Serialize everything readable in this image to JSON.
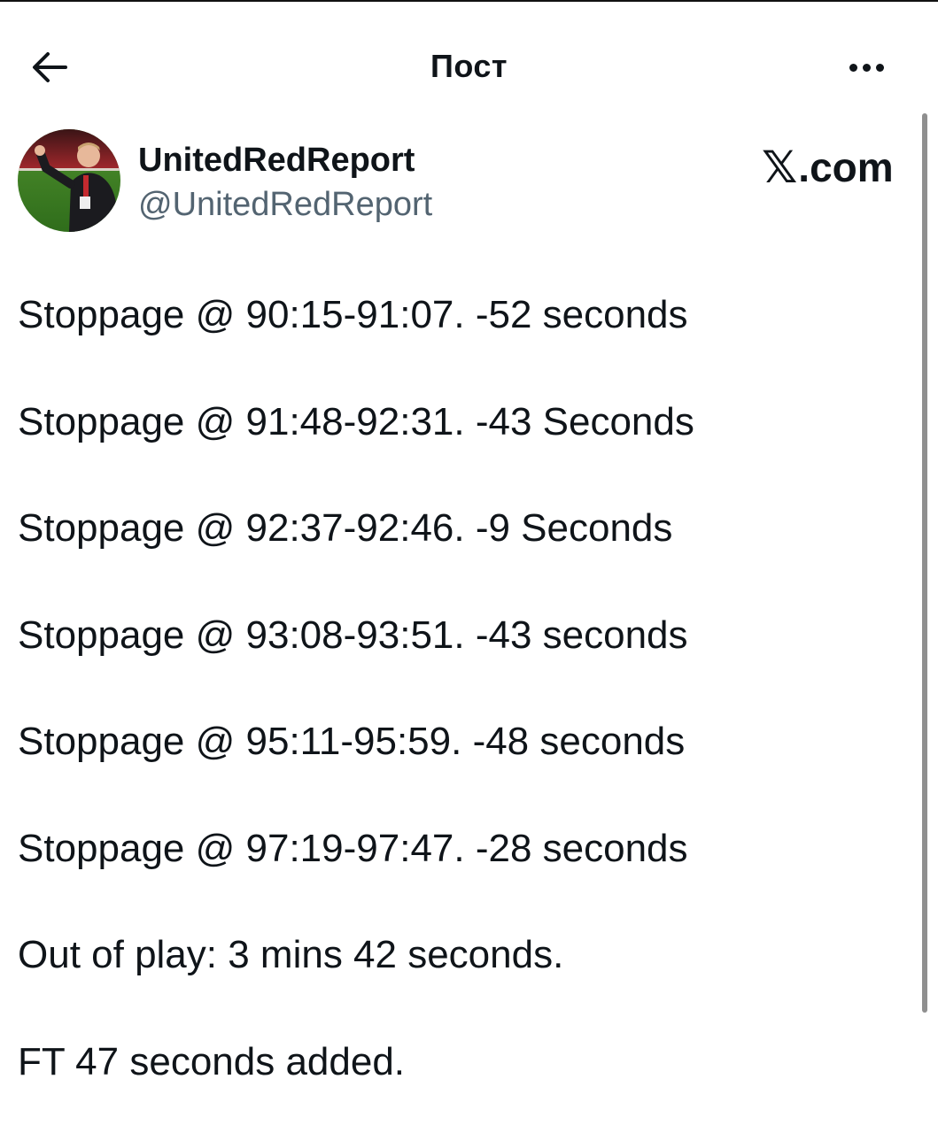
{
  "header": {
    "title": "Пост",
    "back_icon": "arrow-left-icon",
    "more_icon": "more-horizontal-icon"
  },
  "author": {
    "display_name": "UnitedRedReport",
    "handle": "@UnitedRedReport",
    "avatar": "avatar-photo"
  },
  "watermark": {
    "logo": "𝕏",
    "text": ".com"
  },
  "tweet": {
    "lines": [
      "Stoppage @ 90:15-91:07. -52 seconds",
      "Stoppage @ 91:48-92:31. -43 Seconds",
      "Stoppage @ 92:37-92:46. -9 Seconds",
      "Stoppage @ 93:08-93:51. -43 seconds",
      "Stoppage @ 95:11-95:59. -48 seconds",
      "Stoppage @ 97:19-97:47. -28 seconds",
      "Out of play: 3 mins 42 seconds.",
      "FT 47 seconds added."
    ]
  },
  "colors": {
    "text_primary": "#0f1419",
    "text_secondary": "#536471",
    "background": "#ffffff"
  }
}
